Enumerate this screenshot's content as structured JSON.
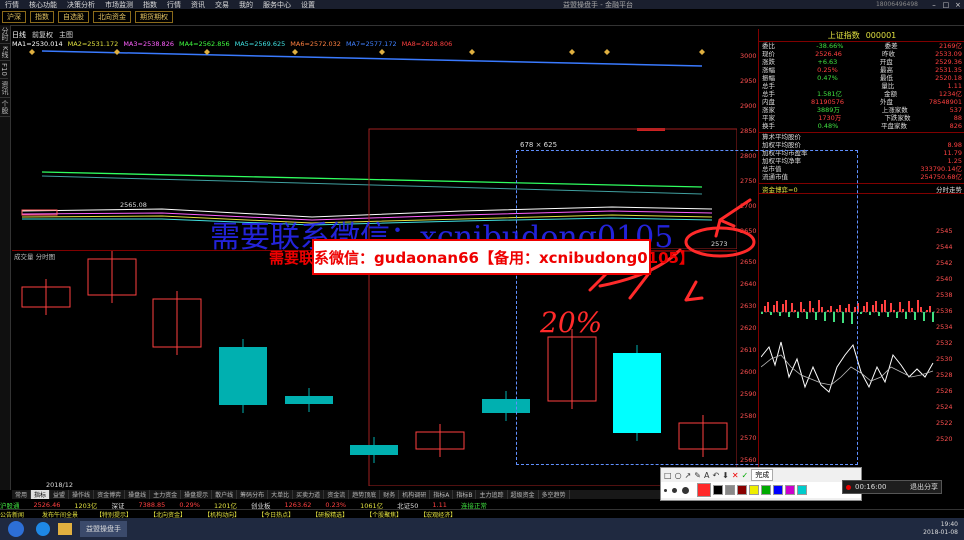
{
  "menu": [
    "行情",
    "核心功能",
    "决策分析",
    "市场监测",
    "指数",
    "行情",
    "资讯",
    "交易",
    "我的",
    "服务中心",
    "设置"
  ],
  "app_title": "益盟操盘手 - 金融平台",
  "account_id": "18006496498",
  "toolbar": [
    "沪深",
    "指数",
    "自选股",
    "北向资金",
    "期货期权"
  ],
  "left_tabs": [
    "分时",
    "K线",
    "F10",
    "资讯",
    "个股"
  ],
  "kline_header": {
    "period": "日线",
    "adjust": "前复权",
    "indicator": "主图"
  },
  "ma_line": [
    "MA1=2530.014",
    "MA2=2531.172",
    "MA3=2538.826",
    "MA4=2562.856",
    "MA5=2569.625",
    "MA6=2572.032",
    "MA7=2577.172",
    "MA8=2628.806"
  ],
  "date_label": "2018/12",
  "price_axis": [
    "3000",
    "2950",
    "2900",
    "2850",
    "2800",
    "2750",
    "2700",
    "2650"
  ],
  "sub_axis": [
    "2650",
    "2640",
    "2630",
    "2620",
    "2610",
    "2600",
    "2590",
    "2580",
    "2570",
    "2560"
  ],
  "price_marks": {
    "high": "2565.08",
    "low": "2573"
  },
  "sub_header": "成交量 分时图",
  "index": {
    "name": "上证指数",
    "code": "000001"
  },
  "quote_rows": [
    {
      "l": "委比",
      "v": "-38.66%",
      "l2": "委差",
      "v2": "2169亿"
    },
    {
      "l": "现价",
      "v": "2526.46",
      "l2": "昨收",
      "v2": "2533.09"
    },
    {
      "l": "涨跌",
      "v": "+6.63",
      "l2": "开盘",
      "v2": "2529.36"
    },
    {
      "l": "涨幅",
      "v": "0.25%",
      "l2": "最高",
      "v2": "2531.35"
    },
    {
      "l": "振幅",
      "v": "0.47%",
      "l2": "最低",
      "v2": "2520.18"
    },
    {
      "l": "总手",
      "v": "",
      "l2": "量比",
      "v2": "1.11"
    },
    {
      "l": "总手",
      "v": "1.581亿",
      "l2": "金额",
      "v2": "1234亿"
    },
    {
      "l": "内盘",
      "v": "81190576",
      "l2": "外盘",
      "v2": "78548901"
    },
    {
      "l": "涨家",
      "v": "3889万",
      "l2": "上涨家数",
      "v2": "537"
    },
    {
      "l": "平家",
      "v": "1730万",
      "l2": "下跌家数",
      "v2": "88"
    },
    {
      "l": "换手",
      "v": "0.48%",
      "l2": "平盘家数",
      "v2": "826"
    }
  ],
  "avg_rows": [
    {
      "l": "算术平均股价",
      "v": ""
    },
    {
      "l": "加权平均股价",
      "v": "8.98"
    },
    {
      "l": "加权平均市盈率",
      "v": "11.79"
    },
    {
      "l": "加权平均净率",
      "v": "1.25"
    },
    {
      "l": "总市值",
      "v": "333790.14亿"
    },
    {
      "l": "流通市值",
      "v": "254750.68亿"
    }
  ],
  "flow_header": {
    "title": "资金博弈=0",
    "right": "分时走势"
  },
  "right_axis": [
    "2545",
    "2544",
    "2542",
    "2540",
    "2538",
    "2536",
    "2534",
    "2532",
    "2530",
    "2528",
    "2526",
    "2524",
    "2522",
    "2520"
  ],
  "bottom_tabs": [
    "常用",
    "指标",
    "益盟",
    "操作线",
    "资金博弈",
    "操盘线",
    "主力资金",
    "操盘提示",
    "散户线",
    "筹码分布",
    "大单比",
    "买卖力道",
    "资金流",
    "趋势顶底",
    "财务",
    "机构调研",
    "指标A",
    "指标B",
    "主力追踪",
    "超级资金",
    "多空趋势"
  ],
  "ticker": [
    {
      "t": "沪股通",
      "c": "green"
    },
    {
      "t": "2526.46",
      "c": "red"
    },
    {
      "t": "1203亿",
      "c": "yellow"
    },
    {
      "t": "深证",
      "c": "white"
    },
    {
      "t": "7388.85",
      "c": "red"
    },
    {
      "t": "0.29%",
      "c": "red"
    },
    {
      "t": "1201亿",
      "c": "yellow"
    },
    {
      "t": "创业板",
      "c": "white"
    },
    {
      "t": "1263.62",
      "c": "red"
    },
    {
      "t": "0.23%",
      "c": "red"
    },
    {
      "t": "1061亿",
      "c": "yellow"
    },
    {
      "t": "北证50",
      "c": "white"
    },
    {
      "t": "1.11",
      "c": "red"
    },
    {
      "t": "连接正常",
      "c": "green"
    }
  ],
  "ticker2": [
    "公告新闻",
    "发布午间全景",
    "【特别提示】",
    "【北向资金】",
    "【机构动向】",
    "【今日热点】",
    "【研报精选】",
    "【个股聚焦】",
    "【宏观经济】"
  ],
  "watermark": "需要联系微信：xcnibudong0105",
  "banner": "需要联系微信：gudaonan66【备用：xcnibudong0105】",
  "annotation_text": "20%",
  "selection_size": "678 × 625",
  "anno_toolbar": {
    "finish": "完成",
    "timer": "00:16:00",
    "exit": "退出分享"
  },
  "taskbar": {
    "app": "益盟操盘手",
    "clock": "19:40",
    "date": "2018-01-08"
  },
  "colors": {
    "up": "#ff4040",
    "down": "#00b0b0",
    "bg": "#000000",
    "accent": "#e00000"
  }
}
